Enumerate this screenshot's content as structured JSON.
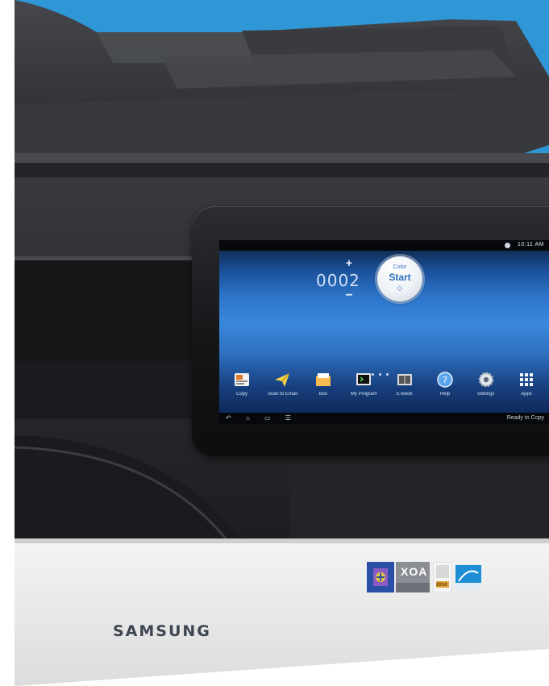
{
  "screen": {
    "status_time": "10:11 AM",
    "copy_count": "0002",
    "plus_symbol": "+",
    "minus_symbol": "−",
    "start_button": {
      "small_label": "Color",
      "label": "Start",
      "icon": "◇"
    },
    "pager_dots": 3,
    "apps": [
      {
        "name": "copy-app",
        "label": "Copy",
        "icon": "copy-icon"
      },
      {
        "name": "scan-email-app",
        "label": "Scan to Email",
        "icon": "send-icon"
      },
      {
        "name": "box-app",
        "label": "Box",
        "icon": "folder-icon"
      },
      {
        "name": "my-program-app",
        "label": "My Program",
        "icon": "terminal-icon"
      },
      {
        "name": "ebook-app",
        "label": "E-Book",
        "icon": "book-icon"
      },
      {
        "name": "help-app",
        "label": "Help",
        "icon": "help-icon"
      },
      {
        "name": "settings-app",
        "label": "Settings",
        "icon": "gear-icon"
      },
      {
        "name": "apps-app",
        "label": "Apps",
        "icon": "grid-icon"
      }
    ],
    "nav_icons": "↶ ⌂ ▭ ☰",
    "nav_status": "Ready to Copy"
  },
  "base": {
    "brand": "SAMSUNG",
    "badge_xoa": "XOA",
    "badge_year": "2014"
  },
  "colors": {
    "backdrop": "#2f97d6",
    "body_dark": "#2b2c30",
    "base_white": "#ececec",
    "accent_blue": "#2d6fbe"
  }
}
